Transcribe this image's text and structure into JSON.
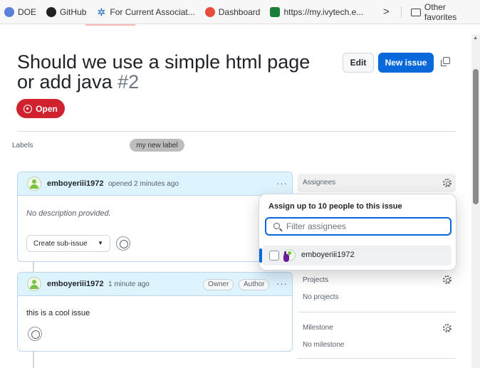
{
  "bookmarks": {
    "items": [
      {
        "label": "DOE"
      },
      {
        "label": "GitHub"
      },
      {
        "label": "For Current Associat..."
      },
      {
        "label": "Dashboard"
      },
      {
        "label": "https://my.ivytech.e..."
      }
    ],
    "overflow": ">",
    "other": "Other favorites"
  },
  "issue": {
    "title": "Should we use a simple html page or add java",
    "number": "#2",
    "state": "Open",
    "edit_label": "Edit",
    "new_issue_label": "New issue"
  },
  "labels": {
    "heading": "Labels",
    "items": [
      "my new label"
    ]
  },
  "comments": [
    {
      "user": "emboyeriii1972",
      "meta": "opened 2 minutes ago",
      "body": "No description provided.",
      "subissue_label": "Create sub-issue",
      "caret": "▼",
      "dots": "···"
    },
    {
      "user": "emboyeriii1972",
      "meta": "1 minute ago",
      "role1": "Owner",
      "role2": "Author",
      "body": "this is a cool issue",
      "dots": "···"
    }
  ],
  "sidebar": {
    "assignees": {
      "title": "Assignees"
    },
    "projects": {
      "title": "Projects",
      "value": "No projects"
    },
    "milestone": {
      "title": "Milestone",
      "value": "No milestone"
    }
  },
  "assignee_popover": {
    "title": "Assign up to 10 people to this issue",
    "filter_placeholder": "Filter assignees",
    "options": [
      {
        "name": "emboyeriii1972",
        "checked": false
      }
    ]
  },
  "colors": {
    "primary": "#0969da",
    "danger": "#cf222e",
    "comment_header": "#ddf4ff"
  }
}
